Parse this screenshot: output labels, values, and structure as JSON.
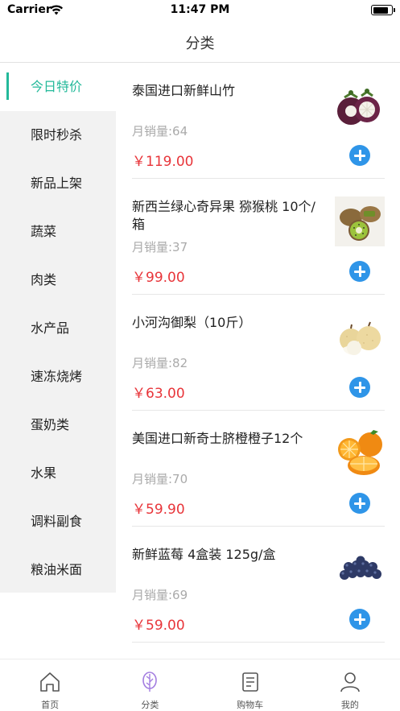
{
  "status_bar": {
    "carrier": "Carrier",
    "time": "11:47 PM",
    "battery_level": 0.9
  },
  "nav": {
    "title": "分类"
  },
  "categories": [
    {
      "label": "今日特价",
      "active": true
    },
    {
      "label": "限时秒杀"
    },
    {
      "label": "新品上架"
    },
    {
      "label": "蔬菜"
    },
    {
      "label": "肉类"
    },
    {
      "label": "水产品"
    },
    {
      "label": "速冻烧烤"
    },
    {
      "label": "蛋奶类"
    },
    {
      "label": "水果"
    },
    {
      "label": "调料副食"
    },
    {
      "label": "粮油米面"
    }
  ],
  "products": [
    {
      "name": "泰国进口新鲜山竹",
      "sales": "月销量:64",
      "price": "￥119.00",
      "thumb": "mangosteen-image"
    },
    {
      "name": "新西兰绿心奇异果 猕猴桃 10个/箱",
      "sales": "月销量:37",
      "price": "￥99.00",
      "thumb": "kiwi-image"
    },
    {
      "name": "小河沟御梨（10斤）",
      "sales": "月销量:82",
      "price": "￥63.00",
      "thumb": "pear-image"
    },
    {
      "name": "美国进口新奇士脐橙橙子12个",
      "sales": "月销量:70",
      "price": "￥59.90",
      "thumb": "orange-image"
    },
    {
      "name": "新鲜蓝莓 4盒装 125g/盒",
      "sales": "月销量:69",
      "price": "￥59.00",
      "thumb": "blueberry-image"
    }
  ],
  "tabs": [
    {
      "label": "首页",
      "icon": "home-icon"
    },
    {
      "label": "分类",
      "icon": "category-icon",
      "active": true
    },
    {
      "label": "购物车",
      "icon": "cart-icon"
    },
    {
      "label": "我的",
      "icon": "profile-icon"
    }
  ],
  "colors": {
    "accent": "#23b99a",
    "price": "#e8353a",
    "add_button": "#2f95e8",
    "sidebar_bg": "#f2f2f2"
  }
}
